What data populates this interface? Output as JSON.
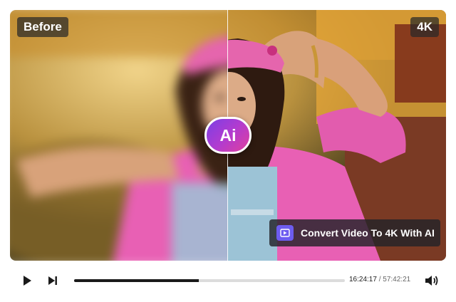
{
  "labels": {
    "before": "Before",
    "after": "4K",
    "ai_badge": "Ai",
    "convert": "Convert Video To 4K With AI"
  },
  "player": {
    "current_time": "16:24:17",
    "separator": " / ",
    "total_time": "57:42:21",
    "progress": 0.46
  },
  "colors": {
    "accent_purple": "#7b3fe4",
    "accent_pink": "#e0409c",
    "progress_fill": "#1a1a1a",
    "progress_track": "#dcdcdc"
  },
  "icons": {
    "play": "play-icon",
    "next": "skip-next-icon",
    "volume": "volume-icon",
    "video": "video-enhance-icon"
  }
}
